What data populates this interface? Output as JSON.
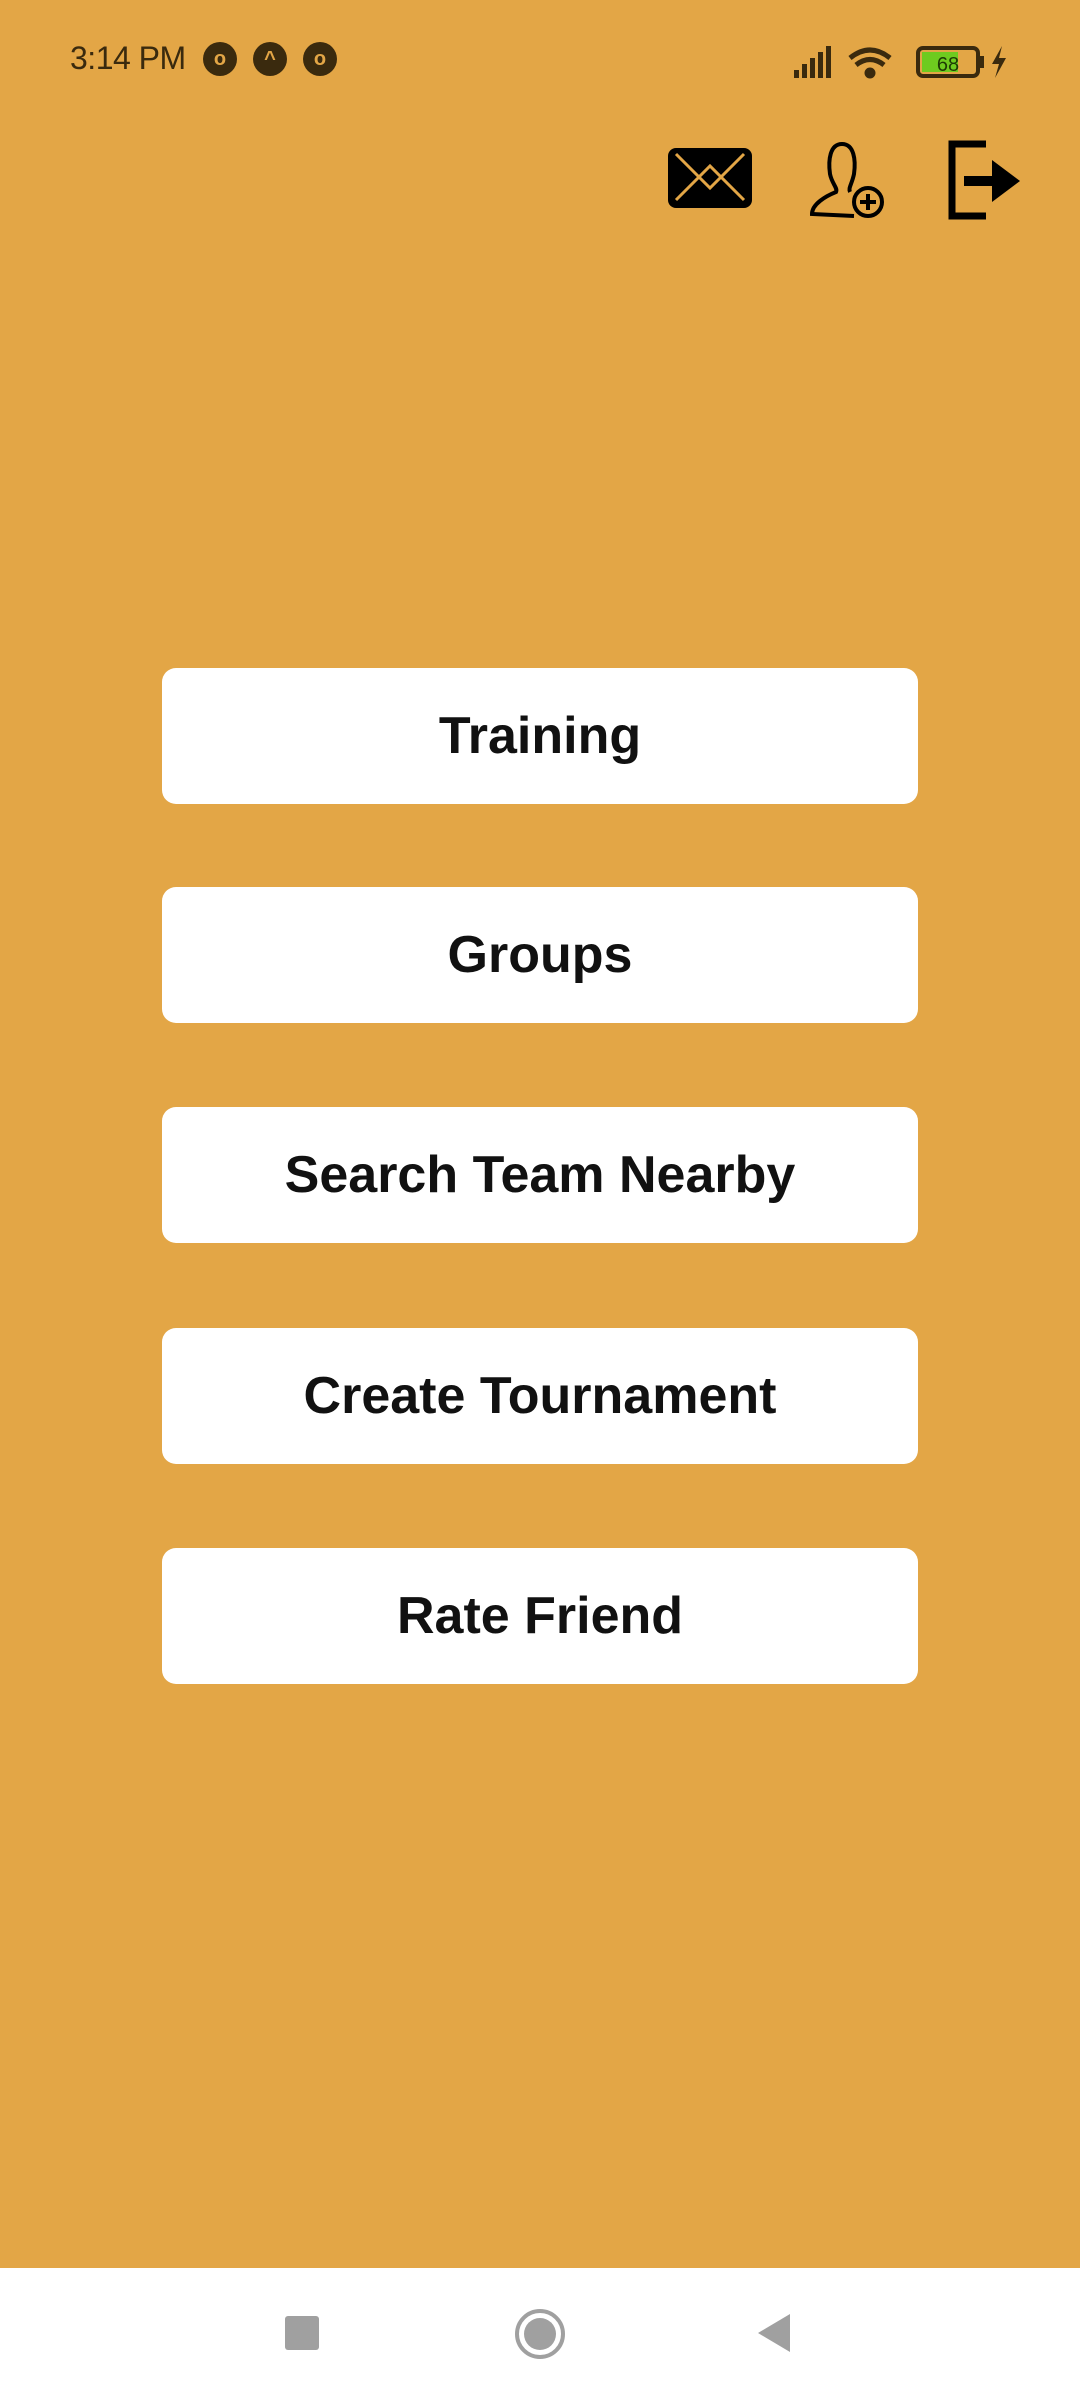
{
  "status_bar": {
    "time": "3:14 PM",
    "notification_icons": [
      "app-icon",
      "arrow-up-icon",
      "app-icon"
    ],
    "battery": "68"
  },
  "header": {
    "icons": [
      "mail-icon",
      "add-user-icon",
      "logout-icon"
    ]
  },
  "menu": {
    "buttons": [
      {
        "label": "Training"
      },
      {
        "label": "Groups"
      },
      {
        "label": "Search Team Nearby"
      },
      {
        "label": "Create Tournament"
      },
      {
        "label": "Rate Friend"
      }
    ]
  },
  "colors": {
    "background": "#E3A646",
    "button": "#FFFFFF",
    "text": "#111111",
    "battery_fill": "#6ecb1f"
  }
}
